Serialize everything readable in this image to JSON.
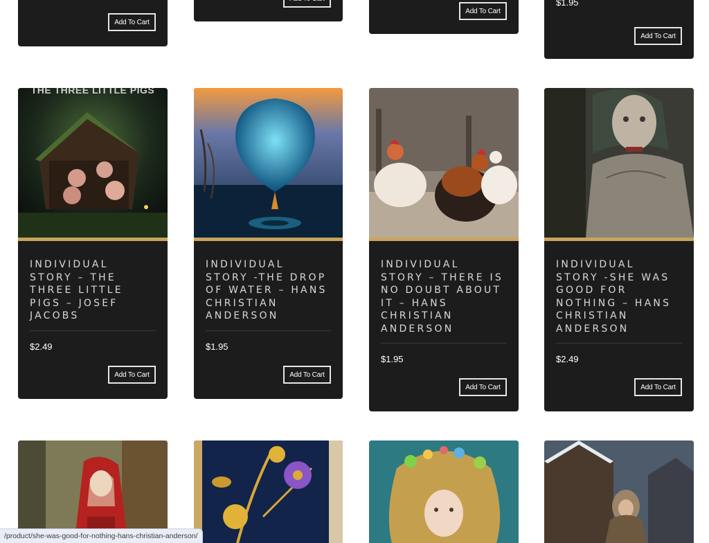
{
  "add_to_cart_label": "Add To Cart",
  "colors": {
    "card_bg": "#1c1c1c",
    "gold_accent": "#c9a45c",
    "button_border": "#e6e6e6"
  },
  "top_row": [
    {
      "price": ""
    },
    {
      "price": ""
    },
    {
      "price": ""
    },
    {
      "price": "$1.95"
    }
  ],
  "products": [
    {
      "title": "INDIVIDUAL STORY – THE THREE LITTLE PIGS – JOSEF JACOBS",
      "price": "$2.49",
      "image": "three-little-pigs-image",
      "image_text": "THE THREE LITTLE PIGS"
    },
    {
      "title": "INDIVIDUAL STORY -THE DROP OF WATER – HANS CHRISTIAN ANDERSON",
      "price": "$1.95",
      "image": "drop-of-water-image"
    },
    {
      "title": "INDIVIDUAL STORY – THERE IS NO DOUBT ABOUT IT – HANS CHRISTIAN ANDERSON",
      "price": "$1.95",
      "image": "chickens-image"
    },
    {
      "title": "INDIVIDUAL STORY -SHE WAS GOOD FOR NOTHING – HANS CHRISTIAN ANDERSON",
      "price": "$2.49",
      "image": "girl-portrait-image"
    }
  ],
  "bottom_row": [
    {
      "image": "red-riding-hood-image"
    },
    {
      "image": "golden-flowers-book-image"
    },
    {
      "image": "flower-crown-girl-image"
    },
    {
      "image": "winter-child-image"
    }
  ],
  "status_bar": {
    "url": "/product/she-was-good-for-nothing-hans-christian-anderson/"
  }
}
